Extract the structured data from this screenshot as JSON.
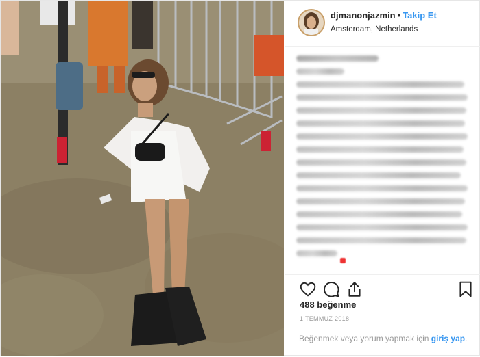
{
  "header": {
    "username": "djmanonjazmin",
    "separator": "•",
    "follow_label": "Takip Et",
    "location": "Amsterdam, Netherlands"
  },
  "photo": {
    "icon": "post-photo"
  },
  "caption": {
    "blurred": true,
    "line_count": 17
  },
  "actions": {
    "like_icon": "heart-icon",
    "comment_icon": "comment-icon",
    "share_icon": "share-icon",
    "save_icon": "bookmark-icon"
  },
  "likes": {
    "text": "488 beğenme"
  },
  "date": {
    "text": "1 TEMMUZ 2018"
  },
  "footer": {
    "prompt": "Beğenmek veya yorum yapmak için ",
    "login_link": "giriş yap",
    "suffix": "."
  },
  "colors": {
    "link": "#3897f0",
    "muted": "#999999",
    "text": "#262626"
  }
}
